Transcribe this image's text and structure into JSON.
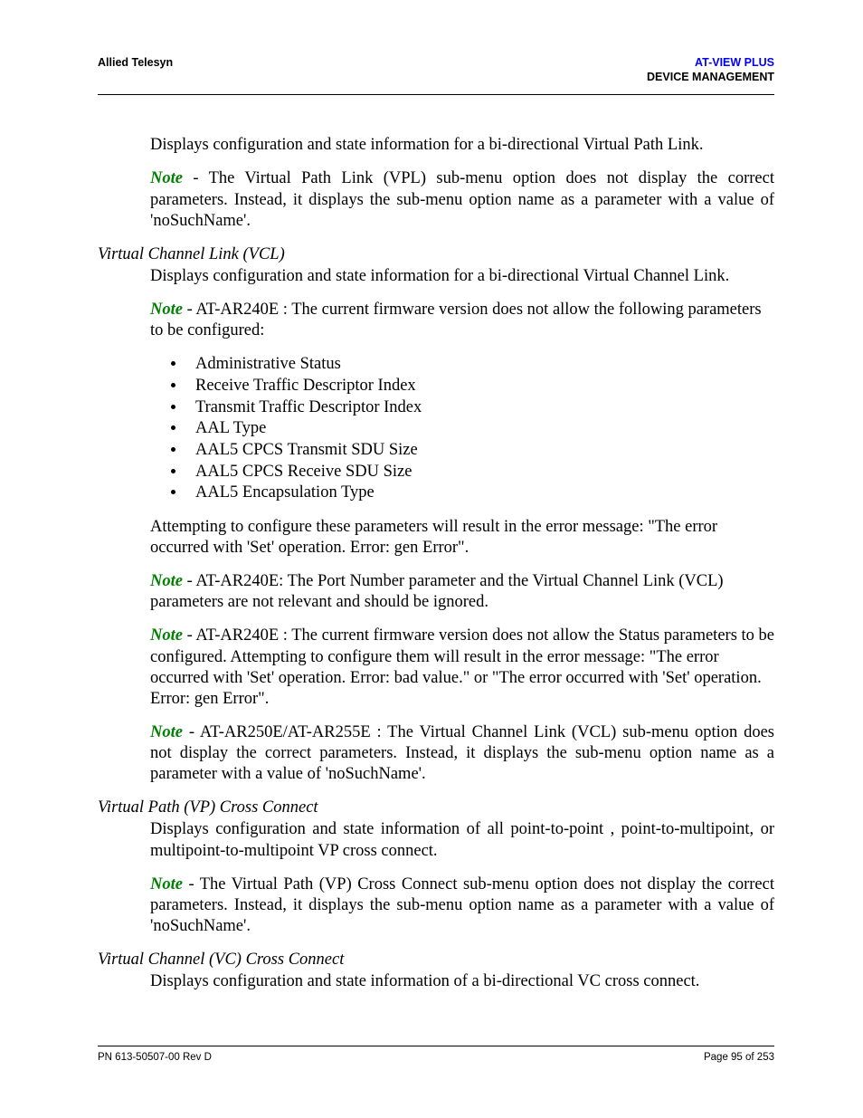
{
  "header": {
    "company": "Allied Telesyn",
    "product": "AT-VIEW PLUS",
    "category": "DEVICE MANAGEMENT"
  },
  "body": {
    "intro_para": "Displays configuration and state information for a bi-directional Virtual Path Link.",
    "note_label": "Note",
    "intro_note": " - The Virtual Path Link (VPL) sub-menu option does not display the correct parameters. Instead, it displays the sub-menu option name as a parameter with a value of 'noSuchName'.",
    "vcl": {
      "heading": "Virtual Channel Link (VCL)",
      "desc": "Displays configuration and state information for a bi-directional Virtual Channel Link.",
      "note1": " - AT-AR240E : The current firmware version does not allow the following parameters to be configured:",
      "list": [
        "Administrative Status",
        "Receive Traffic Descriptor Index",
        "Transmit Traffic Descriptor Index",
        "AAL Type",
        "AAL5 CPCS Transmit SDU Size",
        "AAL5 CPCS Receive SDU Size",
        "AAL5 Encapsulation Type"
      ],
      "after_list": "Attempting to configure these parameters will result in the error message: \"The error occurred with 'Set' operation. Error: gen Error\".",
      "note2": " - AT-AR240E: The Port Number parameter and the Virtual Channel Link (VCL) parameters are not relevant and should be ignored.",
      "note3": " - AT-AR240E : The current firmware version does not allow the Status parameters to be configured. Attempting to configure them will result in the error message: \"The error occurred with 'Set' operation. Error: bad value.\" or \"The error occurred with 'Set' operation. Error: gen Error\".",
      "note4": " - AT-AR250E/AT-AR255E : The Virtual Channel Link (VCL) sub-menu option does not display the correct parameters. Instead, it displays the sub-menu option name as a parameter with a value of 'noSuchName'."
    },
    "vp": {
      "heading": "Virtual Path (VP) Cross Connect",
      "desc": "Displays configuration and state information of all point-to-point , point-to-multipoint, or multipoint-to-multipoint VP cross connect.",
      "note1": " - The Virtual Path (VP) Cross Connect sub-menu option does not display the correct parameters. Instead, it displays the sub-menu option name as a parameter with a value of 'noSuchName'."
    },
    "vc": {
      "heading": "Virtual Channel (VC) Cross Connect",
      "desc": "Displays configuration and state information of a bi-directional VC cross connect."
    }
  },
  "footer": {
    "left": "PN 613-50507-00 Rev D",
    "right": "Page 95 of 253"
  }
}
